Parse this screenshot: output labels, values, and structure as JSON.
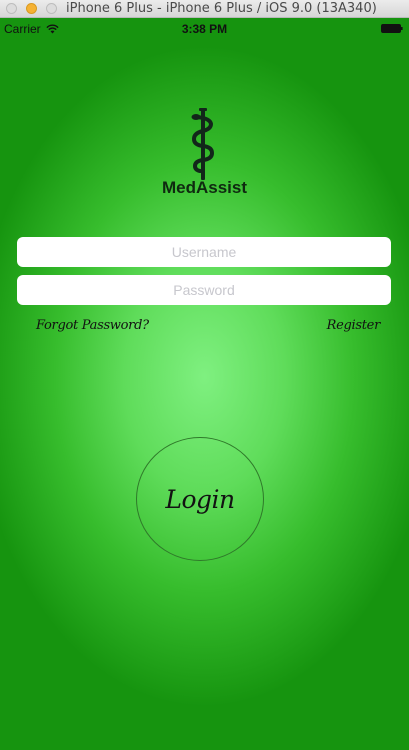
{
  "window": {
    "title": "iPhone 6 Plus - iPhone 6 Plus / iOS 9.0 (13A340)"
  },
  "statusbar": {
    "carrier": "Carrier",
    "time": "3:38 PM",
    "wifi_icon": "wifi-icon",
    "battery_icon": "battery-icon"
  },
  "logo": {
    "icon": "caduceus-icon",
    "app_name": "MedAssist"
  },
  "form": {
    "username_placeholder": "Username",
    "username_value": "",
    "password_placeholder": "Password",
    "password_value": ""
  },
  "links": {
    "forgot_password": "Forgot Password?",
    "register": "Register"
  },
  "login_button": {
    "label": "Login"
  },
  "colors": {
    "background_dark": "#16940f",
    "background_light": "#7ff080",
    "field_background": "#ffffff",
    "placeholder": "#c7c7cd"
  }
}
